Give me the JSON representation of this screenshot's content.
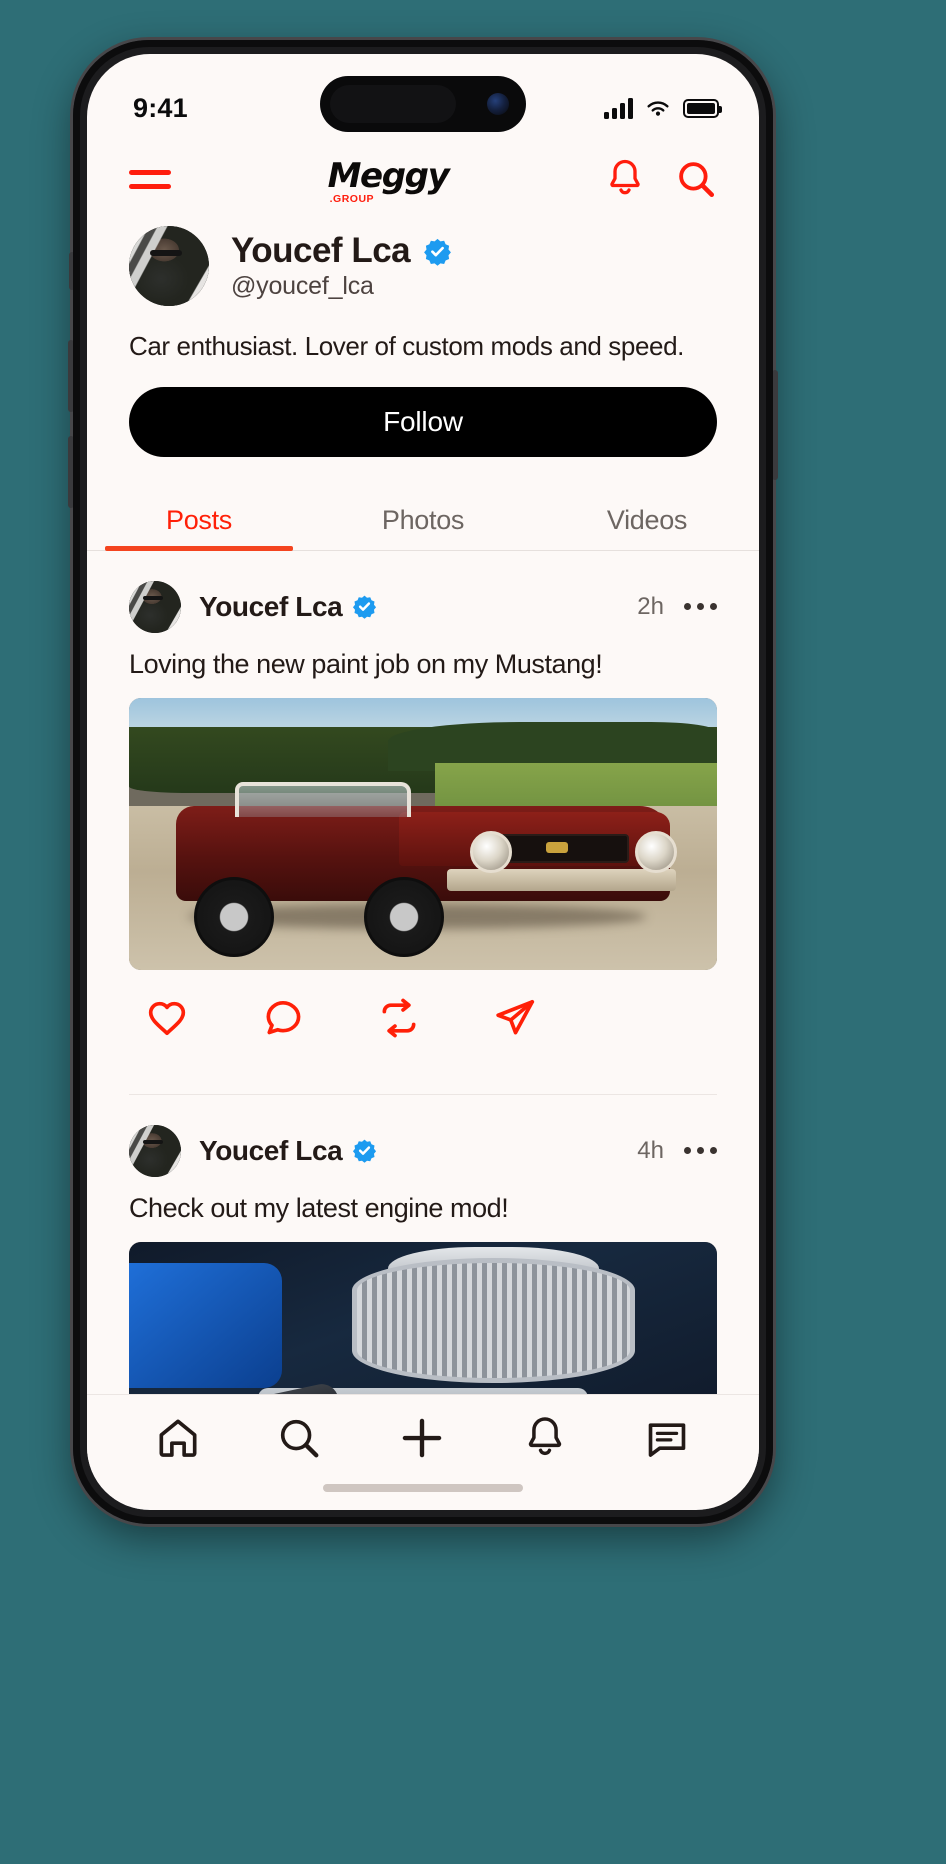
{
  "status_bar": {
    "time": "9:41",
    "signal_icon": "cellular-signal-icon",
    "wifi_icon": "wifi-icon",
    "battery_icon": "battery-icon"
  },
  "app_header": {
    "menu_icon": "hamburger-menu-icon",
    "logo_main": "Meggy",
    "logo_sub": ".GROUP",
    "notifications_icon": "bell-icon",
    "search_icon": "search-icon",
    "accent_color": "#ff1d0d"
  },
  "profile": {
    "avatar": "user-avatar",
    "display_name": "Youcef Lca",
    "verified_icon": "verified-badge-icon",
    "handle": "@youcef_lca",
    "bio": "Car enthusiast. Lover of custom mods and speed.",
    "follow_label": "Follow",
    "follow_bg": "#000000"
  },
  "tabs": {
    "active_color": "#ff2008",
    "inactive_color": "#6d6662",
    "items": [
      {
        "label": "Posts",
        "active": true
      },
      {
        "label": "Photos",
        "active": false
      },
      {
        "label": "Videos",
        "active": false
      }
    ]
  },
  "feed": {
    "posts": [
      {
        "author": "Youcef Lca",
        "verified_icon": "verified-badge-icon",
        "time": "2h",
        "more_icon": "more-options-icon",
        "text": "Loving the new paint job on my Mustang!",
        "image": "red-mustang-convertible-photo",
        "actions": [
          {
            "name": "like",
            "icon": "heart-icon"
          },
          {
            "name": "comment",
            "icon": "comment-bubble-icon"
          },
          {
            "name": "repost",
            "icon": "repost-icon"
          },
          {
            "name": "share",
            "icon": "send-paper-plane-icon"
          }
        ]
      },
      {
        "author": "Youcef Lca",
        "verified_icon": "verified-badge-icon",
        "time": "4h",
        "more_icon": "more-options-icon",
        "text": "Check out my latest engine mod!",
        "image": "chrome-engine-air-filter-photo",
        "actions": []
      }
    ],
    "action_color": "#ff2008"
  },
  "bottom_nav": {
    "items": [
      {
        "name": "home",
        "icon": "home-icon"
      },
      {
        "name": "search",
        "icon": "search-icon"
      },
      {
        "name": "create",
        "icon": "plus-icon"
      },
      {
        "name": "notifications",
        "icon": "bell-icon"
      },
      {
        "name": "messages",
        "icon": "message-icon"
      }
    ],
    "icon_color": "#231a17"
  }
}
